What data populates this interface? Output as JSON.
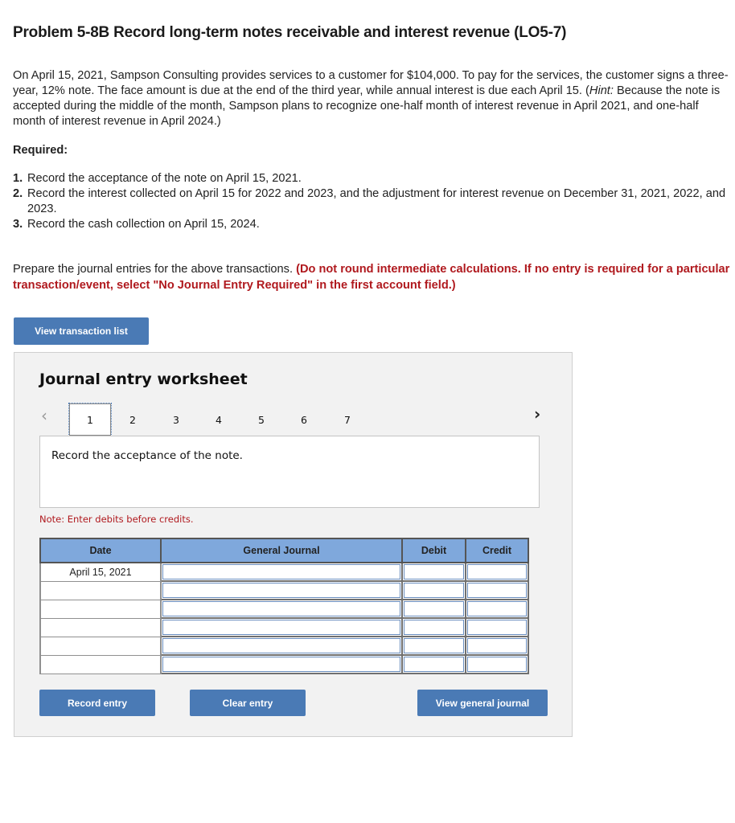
{
  "problem": {
    "title": "Problem 5-8B Record long-term notes receivable and interest revenue (LO5-7)",
    "intro_main": "On April 15, 2021, Sampson Consulting provides services to a customer for $104,000. To pay for the services, the customer signs a three-year, 12% note. The face amount is  due at the end of the third year, while annual interest is due each April 15. (",
    "intro_hint_label": "Hint:",
    "intro_hint_text": " Because the note is accepted during the middle of the month, Sampson plans to recognize one-half month of interest revenue in April 2021, and one-half month of interest revenue in April 2024.)",
    "required_label": "Required:",
    "requirements": [
      {
        "num": "1.",
        "text": "Record the acceptance of the note on April 15, 2021."
      },
      {
        "num": "2.",
        "text": "Record the interest collected on April 15 for 2022 and 2023, and the adjustment for interest revenue on December 31, 2021, 2022, and 2023."
      },
      {
        "num": "3.",
        "text": "Record the cash collection on April 15, 2024."
      }
    ],
    "prepare_text": "Prepare the journal entries for the above transactions. ",
    "prepare_instruction": "(Do not round intermediate calculations. If no entry is required for a particular transaction/event, select \"No Journal Entry Required\" in the first account field.)"
  },
  "buttons": {
    "view_transaction_list": "View transaction list",
    "record_entry": "Record entry",
    "clear_entry": "Clear entry",
    "view_general_journal": "View general journal"
  },
  "worksheet": {
    "title": "Journal entry worksheet",
    "prev_icon": "‹",
    "next_icon": "›",
    "tabs": [
      "1",
      "2",
      "3",
      "4",
      "5",
      "6",
      "7"
    ],
    "active_tab": "1",
    "description": "Record the acceptance of the note.",
    "note": "Note: Enter debits before credits.",
    "columns": {
      "date": "Date",
      "account": "General Journal",
      "debit": "Debit",
      "credit": "Credit"
    },
    "rows": [
      {
        "date": "April 15, 2021",
        "account": "",
        "debit": "",
        "credit": ""
      },
      {
        "date": "",
        "account": "",
        "debit": "",
        "credit": ""
      },
      {
        "date": "",
        "account": "",
        "debit": "",
        "credit": ""
      },
      {
        "date": "",
        "account": "",
        "debit": "",
        "credit": ""
      },
      {
        "date": "",
        "account": "",
        "debit": "",
        "credit": ""
      },
      {
        "date": "",
        "account": "",
        "debit": "",
        "credit": ""
      }
    ]
  },
  "colors": {
    "button_blue": "#4a7ab5",
    "header_blue": "#7fa8dc",
    "instruction_red": "#b0191e",
    "panel_gray": "#f2f2f2"
  }
}
